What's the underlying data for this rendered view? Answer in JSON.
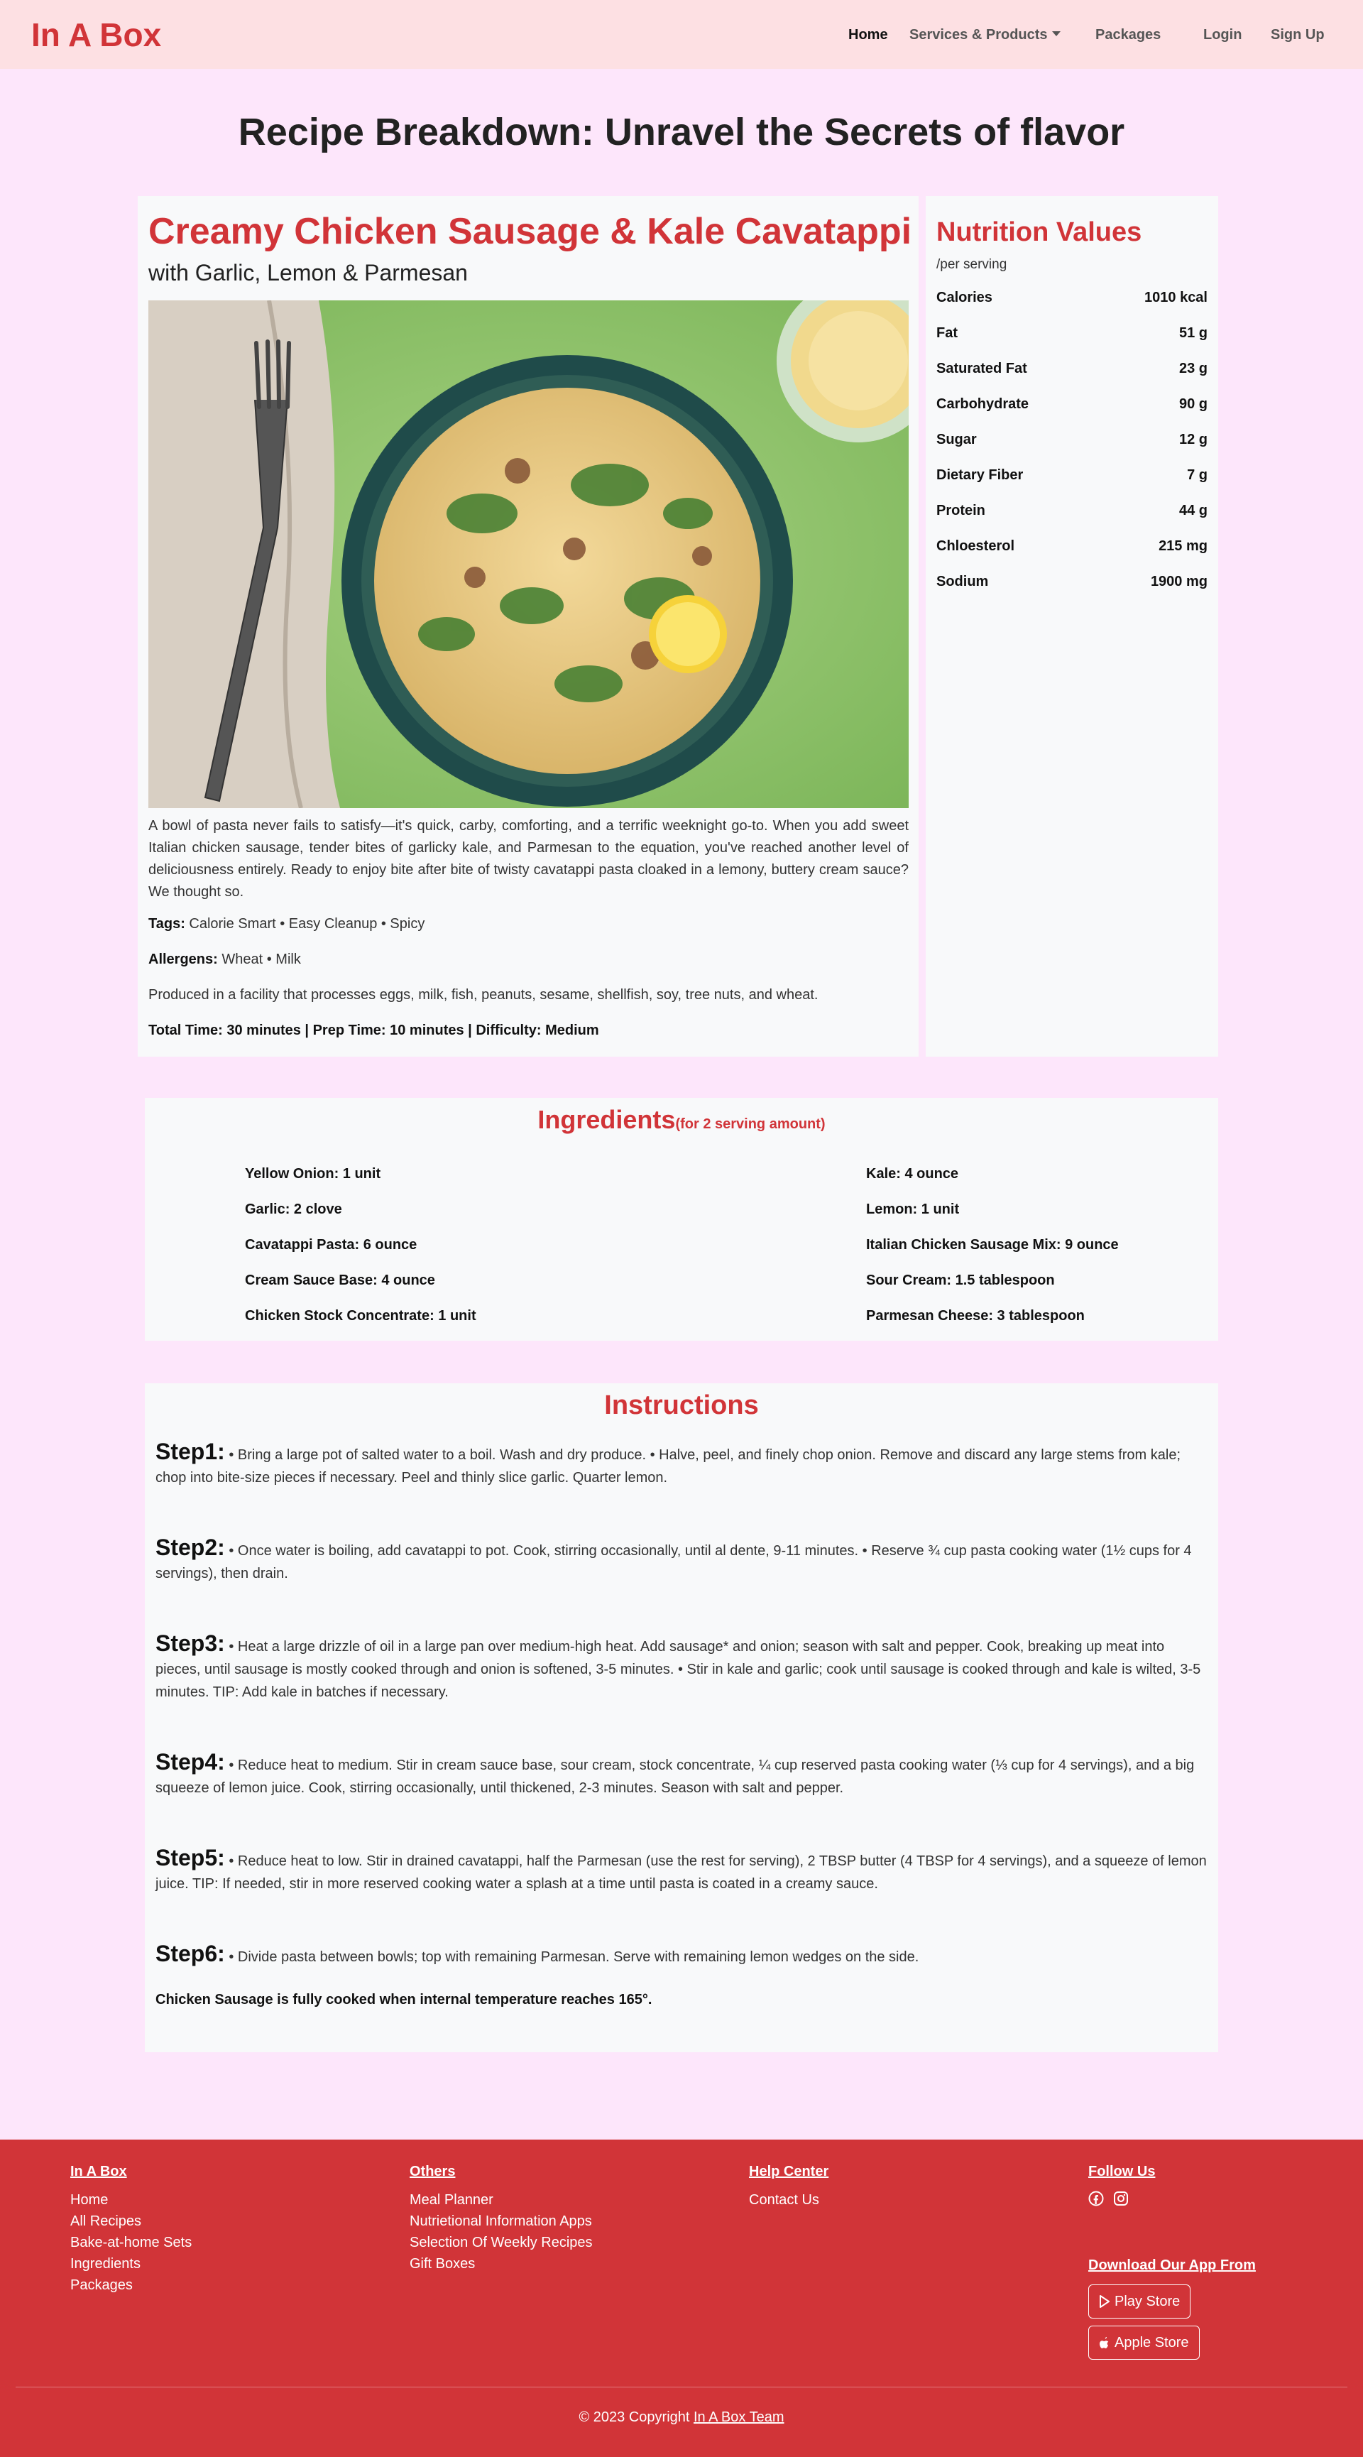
{
  "nav": {
    "brand": "In A Box",
    "home": "Home",
    "services": "Services & Products",
    "packages": "Packages",
    "login": "Login",
    "signup": "Sign Up"
  },
  "page_title": "Recipe Breakdown: Unravel the Secrets of flavor",
  "recipe": {
    "title": "Creamy Chicken Sausage & Kale Cavatappi",
    "subtitle": "with Garlic, Lemon & Parmesan",
    "description": "A bowl of pasta never fails to satisfy—it's quick, carby, comforting, and a terrific weeknight go-to. When you add sweet Italian chicken sausage, tender bites of garlicky kale, and Parmesan to the equation, you've reached another level of deliciousness entirely. Ready to enjoy bite after bite of twisty cavatappi pasta cloaked in a lemony, buttery cream sauce? We thought so.",
    "tags_label": "Tags:",
    "tags": "Calorie Smart • Easy Cleanup • Spicy",
    "allergens_label": "Allergens:",
    "allergens": "Wheat • Milk",
    "facility": "Produced in a facility that processes eggs, milk, fish, peanuts, sesame, shellfish, soy, tree nuts, and wheat.",
    "time_info": "Total Time: 30 minutes | Prep Time: 10 minutes | Difficulty: Medium"
  },
  "nutrition": {
    "title": "Nutrition Values",
    "subtitle": "/per serving",
    "rows": [
      {
        "label": "Calories",
        "value": "1010 kcal"
      },
      {
        "label": "Fat",
        "value": "51 g"
      },
      {
        "label": "Saturated Fat",
        "value": "23 g"
      },
      {
        "label": "Carbohydrate",
        "value": "90 g"
      },
      {
        "label": "Sugar",
        "value": "12 g"
      },
      {
        "label": "Dietary Fiber",
        "value": "7 g"
      },
      {
        "label": "Protein",
        "value": "44 g"
      },
      {
        "label": "Chloesterol",
        "value": "215 mg"
      },
      {
        "label": "Sodium",
        "value": "1900 mg"
      }
    ]
  },
  "ingredients": {
    "title": "Ingredients",
    "subtitle": "(for 2 serving amount)",
    "left": [
      "Yellow Onion: 1 unit",
      "Garlic: 2 clove",
      "Cavatappi Pasta: 6 ounce",
      "Cream Sauce Base: 4 ounce",
      "Chicken Stock Concentrate: 1 unit"
    ],
    "right": [
      "Kale: 4 ounce",
      "Lemon: 1 unit",
      "Italian Chicken Sausage Mix: 9 ounce",
      "Sour Cream: 1.5 tablespoon",
      "Parmesan Cheese: 3 tablespoon"
    ]
  },
  "instructions": {
    "title": "Instructions",
    "steps": [
      {
        "label": "Step1:",
        "text": " • Bring a large pot of salted water to a boil. Wash and dry produce. • Halve, peel, and finely chop onion. Remove and discard any large stems from kale; chop into bite-size pieces if necessary. Peel and thinly slice garlic. Quarter lemon."
      },
      {
        "label": "Step2:",
        "text": " • Once water is boiling, add cavatappi to pot. Cook, stirring occasionally, until al dente, 9-11 minutes. • Reserve ¾ cup pasta cooking water (1½ cups for 4 servings), then drain."
      },
      {
        "label": "Step3:",
        "text": " • Heat a large drizzle of oil in a large pan over medium-high heat. Add sausage* and onion; season with salt and pepper. Cook, breaking up meat into pieces, until sausage is mostly cooked through and onion is softened, 3-5 minutes. • Stir in kale and garlic; cook until sausage is cooked through and kale is wilted, 3-5 minutes. TIP: Add kale in batches if necessary."
      },
      {
        "label": "Step4:",
        "text": " • Reduce heat to medium. Stir in cream sauce base, sour cream, stock concentrate, ¼ cup reserved pasta cooking water (⅓ cup for 4 servings), and a big squeeze of lemon juice. Cook, stirring occasionally, until thickened, 2-3 minutes. Season with salt and pepper."
      },
      {
        "label": "Step5:",
        "text": " • Reduce heat to low. Stir in drained cavatappi, half the Parmesan (use the rest for serving), 2 TBSP butter (4 TBSP for 4 servings), and a squeeze of lemon juice. TIP: If needed, stir in more reserved cooking water a splash at a time until pasta is coated in a creamy sauce."
      },
      {
        "label": "Step6:",
        "text": " • Divide pasta between bowls; top with remaining Parmesan. Serve with remaining lemon wedges on the side."
      }
    ],
    "note": "Chicken Sausage is fully cooked when internal temperature reaches 165°."
  },
  "footer": {
    "col1": {
      "head": "In A Box",
      "links": [
        "Home",
        "All Recipes",
        "Bake-at-home Sets",
        "Ingredients",
        "Packages"
      ]
    },
    "col2": {
      "head": "Others",
      "links": [
        "Meal Planner",
        "Nutrietional Information Apps",
        "Selection Of Weekly Recipes",
        "Gift Boxes"
      ]
    },
    "col3": {
      "head": "Help Center",
      "links": [
        "Contact Us"
      ]
    },
    "col4": {
      "head": "Follow Us",
      "social": [
        "facebook-icon",
        "instagram-icon"
      ]
    },
    "download_head": "Download Our App From",
    "play_store": "Play Store",
    "apple_store": "Apple Store",
    "copyright_prefix": "© 2023 Copyright ",
    "copyright_link": "In A Box Team"
  },
  "colors": {
    "accent": "#d13438",
    "page_bg": "#fde6fb",
    "nav_bg": "#fde0e3",
    "card_bg": "#f8f9fa"
  }
}
